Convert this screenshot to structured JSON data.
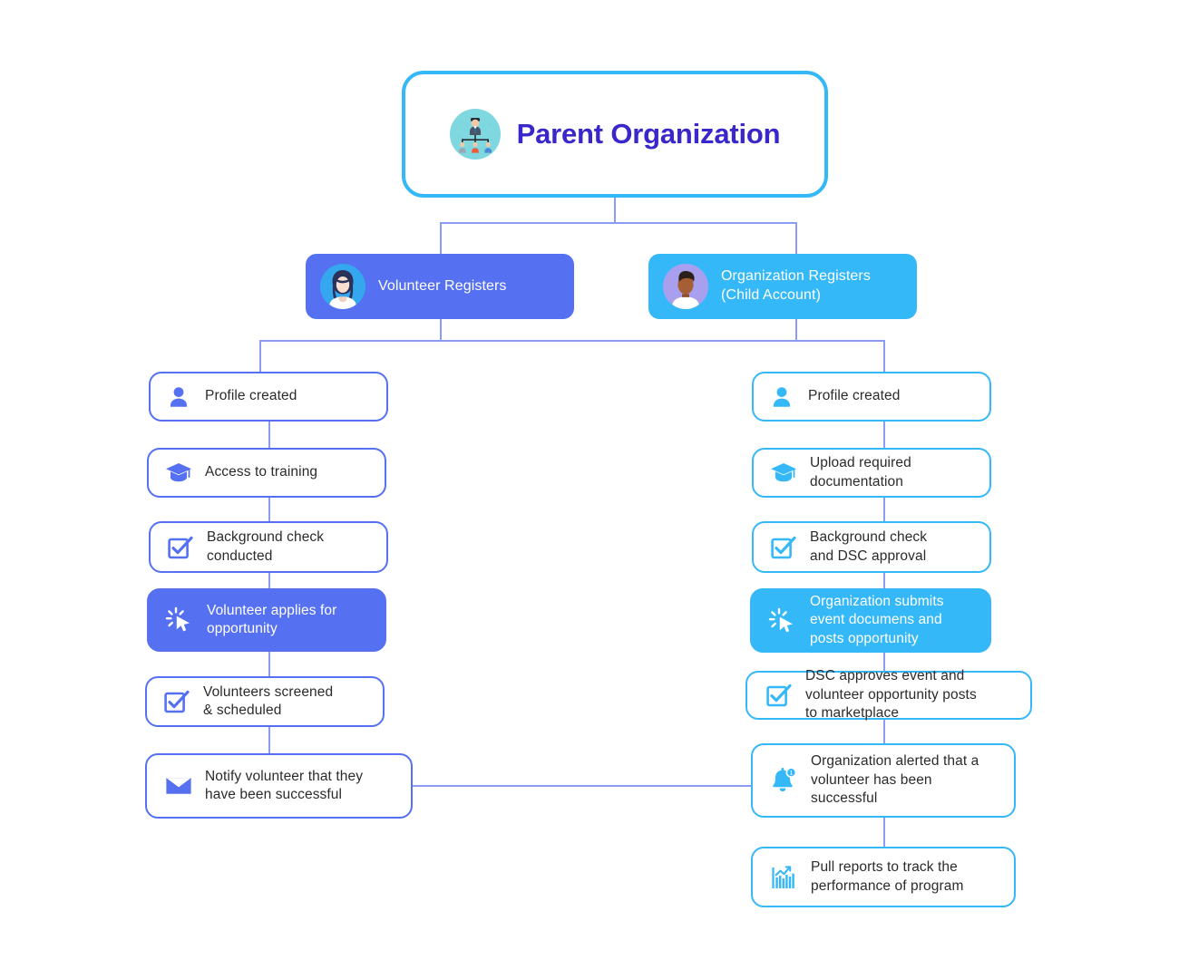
{
  "diagram": {
    "title": "Parent Organization",
    "title_icon": "org-chart-icon",
    "branches": [
      {
        "id": "volunteer",
        "label": "Volunteer Registers",
        "icon": "female-avatar-icon",
        "color": "#5570f1",
        "steps": [
          {
            "label": "Profile created",
            "icon": "person-icon",
            "style": "outline"
          },
          {
            "label": "Access to training",
            "icon": "graduation-cap-icon",
            "style": "outline"
          },
          {
            "label": "Background check\nconducted",
            "icon": "checkbox-checked-icon",
            "style": "outline"
          },
          {
            "label": "Volunteer applies for\nopportunity",
            "icon": "click-cursor-icon",
            "style": "filled"
          },
          {
            "label": "Volunteers screened\n& scheduled",
            "icon": "checkbox-checked-icon",
            "style": "outline"
          },
          {
            "label": "Notify volunteer that they\nhave been successful",
            "icon": "envelope-icon",
            "style": "outline"
          }
        ]
      },
      {
        "id": "organization",
        "label": "Organization Registers\n(Child Account)",
        "icon": "male-avatar-icon",
        "color": "#35b8f7",
        "steps": [
          {
            "label": "Profile created",
            "icon": "person-icon",
            "style": "outline"
          },
          {
            "label": "Upload required\ndocumentation",
            "icon": "graduation-cap-icon",
            "style": "outline"
          },
          {
            "label": "Background check\nand DSC approval",
            "icon": "checkbox-checked-icon",
            "style": "outline"
          },
          {
            "label": "Organization submits\nevent documens and\nposts opportunity",
            "icon": "click-cursor-icon",
            "style": "filled"
          },
          {
            "label": "DSC approves event  and\nvolunteer opportunity posts\nto marketplace",
            "icon": "checkbox-checked-icon",
            "style": "outline"
          },
          {
            "label": "Organization alerted that a\nvolunteer has been\nsuccessful",
            "icon": "bell-notification-icon",
            "style": "outline"
          },
          {
            "label": "Pull reports to track the\nperformance of program",
            "icon": "bar-chart-icon",
            "style": "outline"
          }
        ]
      }
    ],
    "colors": {
      "indigo": "#5570f1",
      "sky": "#35b8f7",
      "connector": "#8a9cf5",
      "title_text": "#3a27cb",
      "body_text": "#2b2b2b",
      "background": "#ffffff"
    }
  }
}
